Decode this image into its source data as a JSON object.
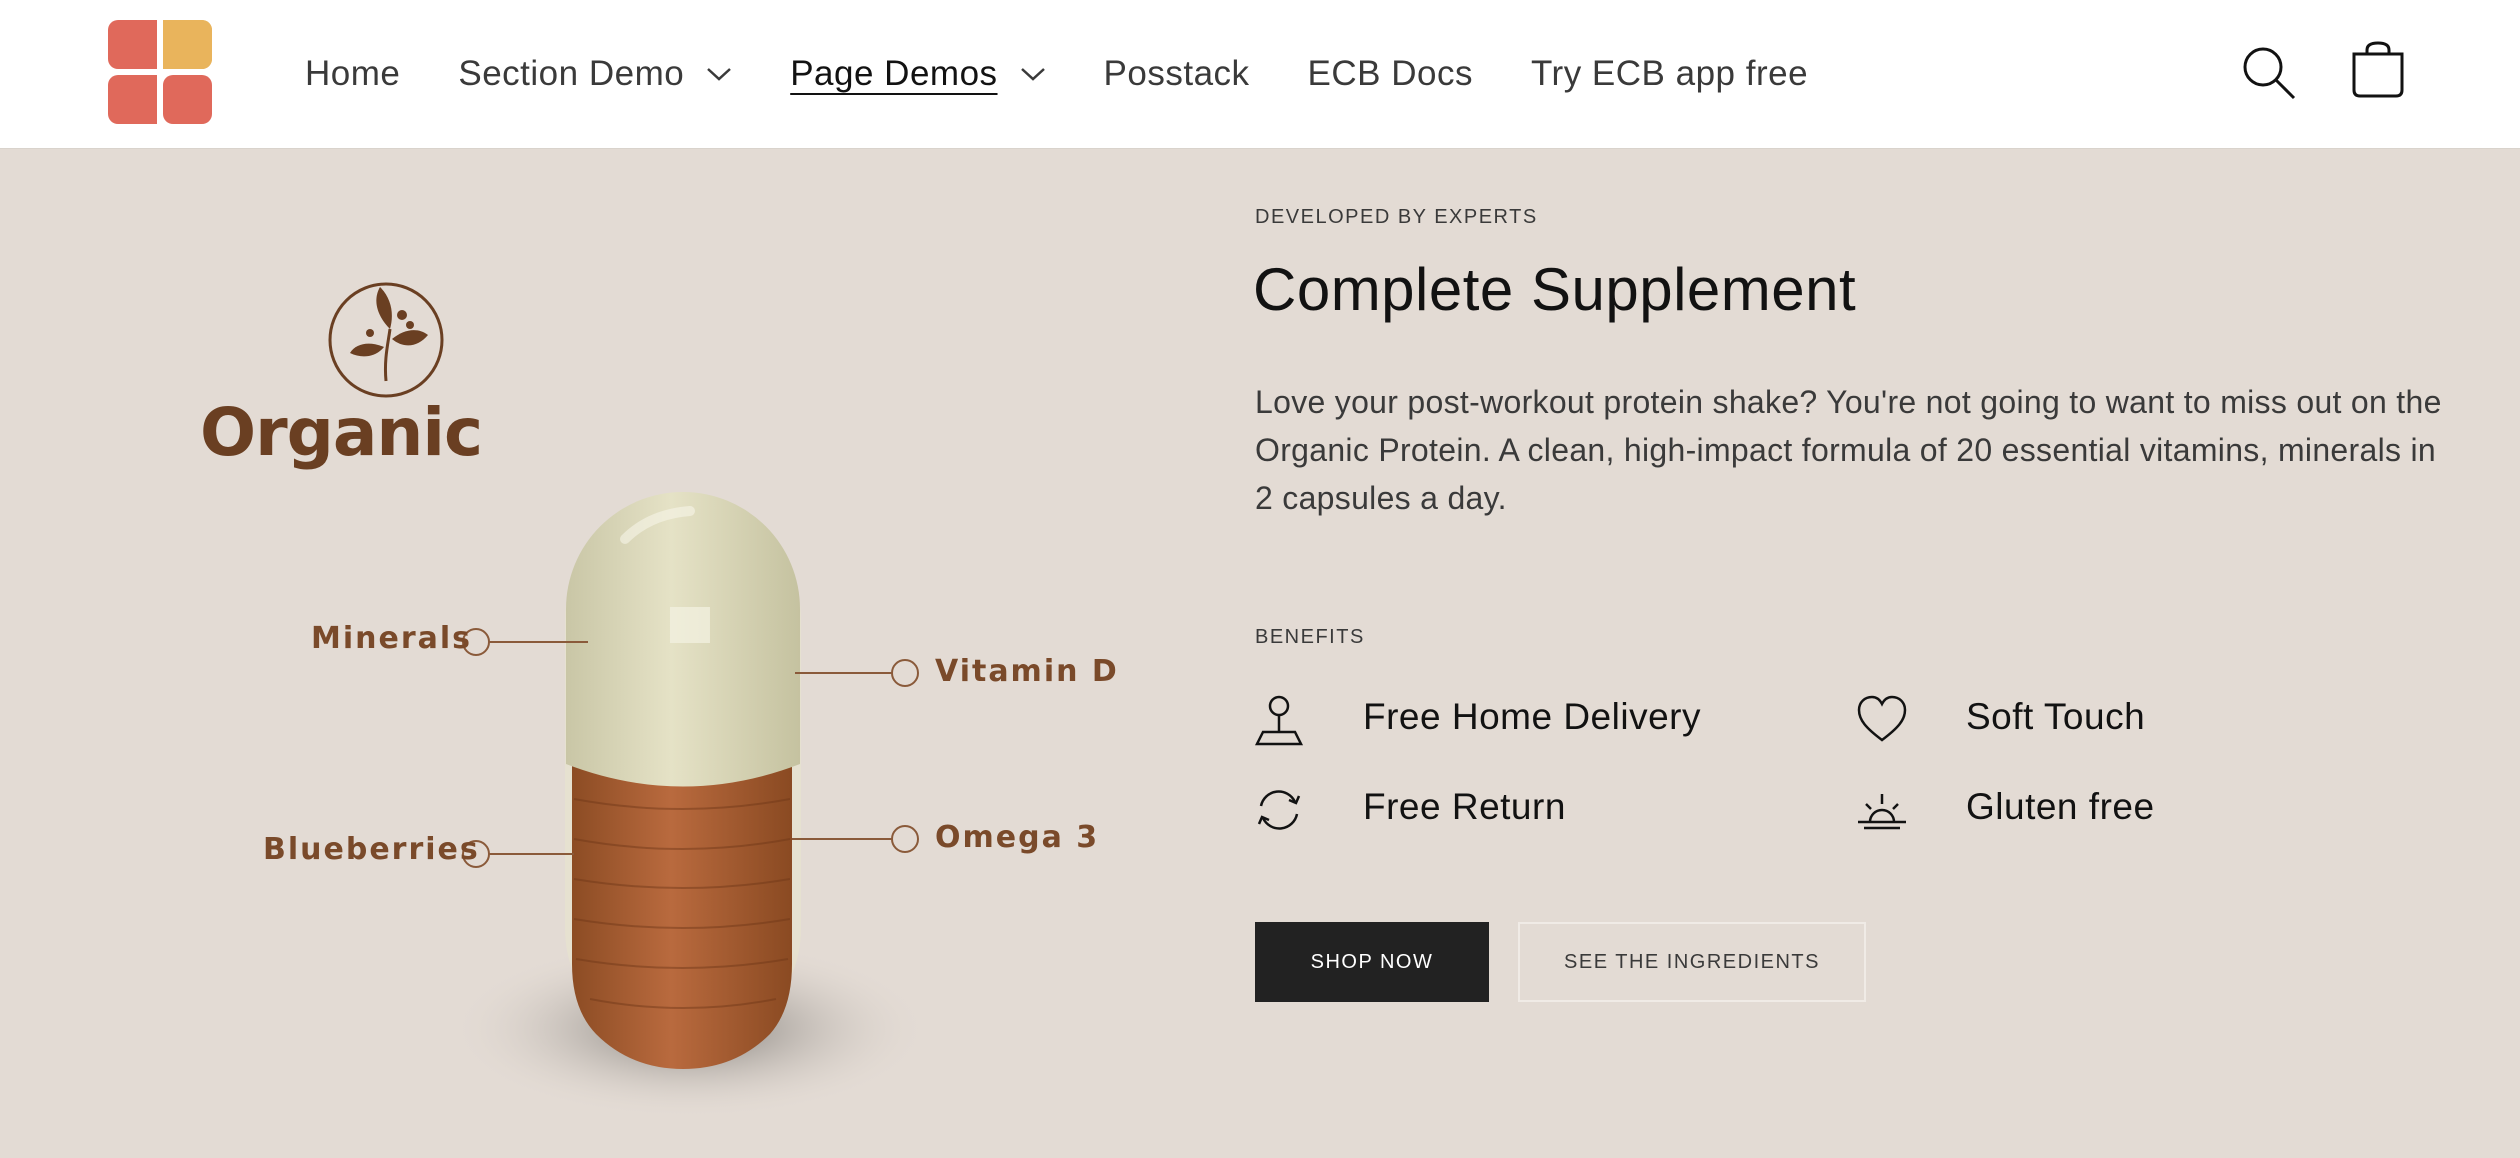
{
  "header": {
    "nav": [
      {
        "label": "Home"
      },
      {
        "label": "Section Demo"
      },
      {
        "label": "Page Demos"
      },
      {
        "label": "Posstack"
      },
      {
        "label": "ECB Docs"
      },
      {
        "label": "Try ECB app free"
      }
    ],
    "icons": [
      "logo-icon",
      "search-icon",
      "cart-icon",
      "chevron-down-icon"
    ]
  },
  "illustration": {
    "brand": "Organic",
    "callouts": {
      "minerals": "Minerals",
      "vitamin_d": "Vitamin D",
      "blueberries": "Blueberries",
      "omega3": "Omega 3"
    }
  },
  "hero": {
    "eyebrow": "DEVELOPED BY EXPERTS",
    "title": "Complete Supplement",
    "description": "Love your post-workout protein shake? You're not going to want to miss out on the Organic Protein. A clean, high-impact formula of 20 essential vitamins, minerals in 2 capsules a day.",
    "benefits_label": "BENEFITS",
    "benefits": [
      {
        "label": "Free Home Delivery",
        "icon": "delivery-pin-icon"
      },
      {
        "label": "Soft Touch",
        "icon": "heart-icon"
      },
      {
        "label": "Free Return",
        "icon": "return-arrows-icon"
      },
      {
        "label": "Gluten free",
        "icon": "sunrise-icon"
      }
    ],
    "primary_button": "SHOP NOW",
    "secondary_button": "SEE THE INGREDIENTS"
  },
  "colors": {
    "header_bg": "#ffffff",
    "hero_bg": "#e3dbd4",
    "logo_red": "#e0695b",
    "logo_yellow": "#e9b45c",
    "brand_brown": "#6a3f22",
    "button_dark": "#222222"
  }
}
